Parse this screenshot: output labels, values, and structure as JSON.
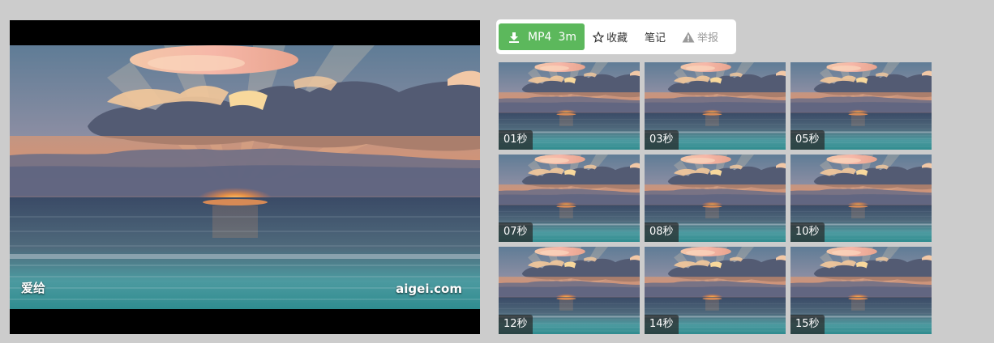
{
  "player": {
    "watermark_left": "爱给",
    "watermark_right": "aigei.com"
  },
  "toolbar": {
    "download_format": "MP4",
    "download_duration": "3m",
    "favorite_label": "收藏",
    "notes_label": "笔记",
    "report_label": "举报",
    "download_icon": "download-icon",
    "favorite_icon": "star-outline-icon",
    "report_icon": "warning-triangle-icon"
  },
  "thumbnails": [
    {
      "time": "01秒"
    },
    {
      "time": "03秒"
    },
    {
      "time": "05秒"
    },
    {
      "time": "07秒"
    },
    {
      "time": "08秒"
    },
    {
      "time": "10秒"
    },
    {
      "time": "12秒"
    },
    {
      "time": "14秒"
    },
    {
      "time": "15秒"
    }
  ],
  "colors": {
    "background": "#cccccc",
    "download_green": "#5cb85c",
    "toolbar_bg": "#ffffff"
  }
}
